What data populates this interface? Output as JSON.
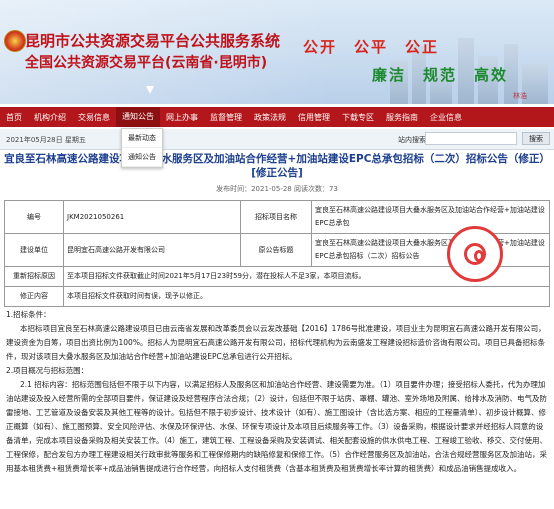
{
  "header": {
    "title_line1": "昆明市公共资源交易平台公共服务系统",
    "title_line2": "全国公共资源交易平台(云南省·昆明市)",
    "slogan_line1": "公开　公平　公正",
    "slogan_line2": "廉洁　规范　高效",
    "stamp_text": "林浩"
  },
  "nav": {
    "items": [
      "首页",
      "机构介绍",
      "交易信息",
      "通知公告",
      "网上办事",
      "监督管理",
      "政策法规",
      "信用管理",
      "下载专区",
      "服务指南",
      "企业信息"
    ]
  },
  "dropdown": {
    "items": [
      "最新动态",
      "通知公告"
    ]
  },
  "infobar": {
    "date": "2021年05月28日 星期五",
    "search_label": "站内搜索",
    "search_placeholder": "",
    "search_button": "搜索"
  },
  "article": {
    "title": "宜良至石林高速公路建设项目大叠水服务区及加油站合作经营+加油站建设EPC总承包招标（二次）招标公告（修正）[修正公告]",
    "meta": "发布时间：2021-05-28 阅读次数：73",
    "rows": {
      "number_label": "编号",
      "number_value": "JKM2021050261",
      "project_name_label": "招标项目名称",
      "project_name_value": "宜良至石林高速公路建设项目大叠水服务区及加油站合作经营+加油站建设EPC总承包",
      "unit_label": "建设单位",
      "unit_value": "昆明宜石高速公路开发有限公司",
      "orig_title_label": "原公告标题",
      "orig_title_value": "宜良至石林高速公路建设项目大叠水服务区及加油站合作经营+加油站建设EPC总承包招标（二次）招标公告",
      "reason_label": "重新招标原因",
      "reason_value": "至本项目招标文件获取截止时间2021年5月17日23时59分，潜在投标人不足3家，本项目流标。",
      "content_label": "修正内容",
      "content_value": "本项目招标文件获取时间有误，现予以修正。"
    },
    "body": [
      "1.招标条件：",
      "本招标项目宜良至石林高速公路建设项目已由云南省发展和改革委员会以云发改基础【2016】1786号批准建设，项目业主为昆明宜石高速公路开发有限公司，建设资金为自筹，项目出资比例为100%。招标人为昆明宜石高速公路开发有限公司，招标代理机构为云南盛发工程建设招标造价咨询有限公司。项目已具备招标条件，现对该项目大叠水服务区及加油站合作经营+加油站建设EPC总承包进行公开招标。",
      "2.项目概况与招标范围：",
      "2.1 招标内容：招标范围包括但不限于以下内容，以满足招标人及服务区和加油站合作经营、建设需要为准。（1）项目要件办理；接受招标人委托，代为办理加油站建设及投入经营所需的全部项目要件，保证建设及经营程序合法合规；（2）设计，包括但不限于站房、罩棚、罐池、室外场地及附属、给排水及消防、电气及防雷接地、工艺管道及设备安装及其他工程等的设计。包括但不限于初步设计、技术设计（如有）、施工图设计（含比选方案、相应的工程量清单）、初步设计概算、修正概算（如有）、施工图预算、安全风险评估、水保及环保评估、水保、环保专项设计及本项目后续服务等工作。（3）设备采购，根据设计要求并经招标人同意的设备清单，完成本项目设备采购及相关安装工作。（4）施工，建筑工程、工程设备采购及安装调试、相关配套设施的供水供电工程、工程竣工验收、移交、交付使用、工程保修，配合发包方办理工程建设相关行政审批等服务和工程保修期内的缺陷修复和保修工作。（5）合作经营服务区及加油站，合法合规经营服务区及加油站，采用基本租赁费+租赁费增长率+成品油销售提成进行合作经营，向招标人支付租赁费（含基本租赁费及租赁费增长率计算的租赁费）和成品油销售提成收入。"
    ]
  }
}
